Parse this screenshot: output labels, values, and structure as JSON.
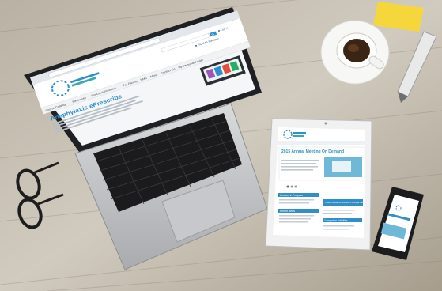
{
  "scene": {
    "description_label": "Laptop, tablet and phone showing the same website on a wooden desk"
  },
  "laptop_site": {
    "url": "",
    "search_button": "Q",
    "login_link": "■ Log in",
    "register_link": "■ NCAMS Register",
    "nav": [
      "Course Catalog",
      "Resources",
      "For Local Providers",
      "For Faculty",
      "NMS",
      "About",
      "Contact Us",
      "My Personal Folder"
    ],
    "headline": "Anaphylaxis ePrescribe"
  },
  "tablet_site": {
    "feature_title": "2015 Annual Meeting On Demand",
    "sidebar": [
      "Courses in Progress",
      "Recent News",
      "Video Guide for the 2015 Annual Meeting",
      "Completion Activities"
    ]
  },
  "colors": {
    "accent_blue": "#2f8fc8",
    "teal": "#36a7b3",
    "wood": "#b7ad9c"
  }
}
